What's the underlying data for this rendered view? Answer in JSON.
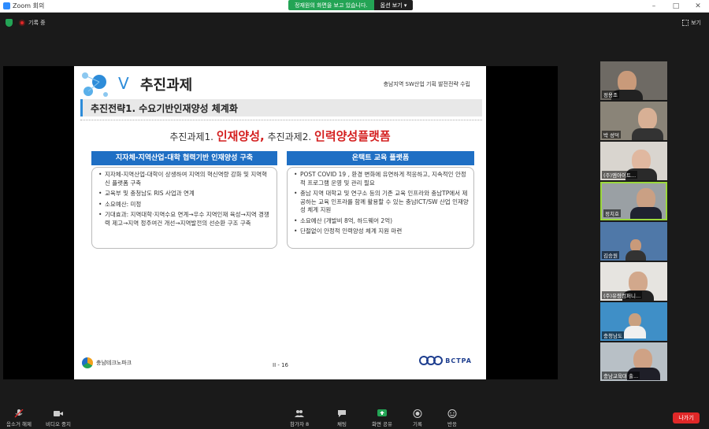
{
  "window": {
    "title": "Zoom 회의",
    "share_message": "정재원의 화면을 보고 있습니다.",
    "view_options": "옵션 보기",
    "controls": [
      "–",
      "□",
      "✕"
    ]
  },
  "status": {
    "recording": "기록 중",
    "view_label": "보기"
  },
  "slide": {
    "roman": "V",
    "title": "추진과제",
    "subtitle": "충남지역 SW산업 기획 발전전략 수립",
    "strategy": "추진전략1. 수요기반인재양성 체계화",
    "tasks": {
      "prefix1": "추진과제1.",
      "name1": "인재양성,",
      "prefix2": "추진과제2.",
      "name2": "인력양성플랫폼"
    },
    "left": {
      "heading": "지자체-지역산업-대학 협력기반 인재양성 구축",
      "items": [
        "지자체-지역산업-대학이 상생하여 지역의 혁신역량 강화 및 지역혁신 플랫폼 구축",
        "교육부 및 충청남도 RIS 사업과 연계",
        "소요예산: 미정",
        "기대효과: 지역대학·지역수요 연계→우수 지역인재 육성→지역 경쟁력 제고→지역 정주여건 개선→지역발전의 선순환 구조 구축"
      ]
    },
    "right": {
      "heading": "온택트 교육 플랫폼",
      "items": [
        "POST COVID 19 , 환경 변화에 유연하게 적응하고, 지속적인 안정적 프로그램 운영 및 관리 필요",
        "충남 지역 대학교 및 연구소 등의 기존 교육 인프라와 충남TP에서 제공하는 교육 인프라를 함께 활용할 수 있는 충남ICT/SW 산업 인재양성 체계 지원",
        "소요예산 (개발비 8억, 하드웨어 2억)",
        "단절없이 안정적 인력양성 체계 지원 마련"
      ]
    },
    "footer": {
      "left_logo": "충남테크노파크",
      "page": "II - 16",
      "right_logo": "BCTPA"
    }
  },
  "participants": [
    {
      "name": "정용조"
    },
    {
      "name": "박 성덕"
    },
    {
      "name": "(주)엠아이트..."
    },
    {
      "name": "정치호"
    },
    {
      "name": "김승원"
    },
    {
      "name": "(주)유령컴퍼니..."
    },
    {
      "name": "충청남도"
    },
    {
      "name": "충남교육대 출..."
    }
  ],
  "toolbar": {
    "mute": "음소거 해제",
    "video": "비디오 중지",
    "participants": "참가자",
    "participants_count": "8",
    "chat": "채팅",
    "share": "화면 공유",
    "record": "기록",
    "reactions": "반응",
    "leave": "나가기"
  },
  "colors": {
    "accent_blue": "#1f6fc4",
    "share_green": "#23a455",
    "leave_red": "#e02828",
    "highlight_red": "#d42020"
  }
}
